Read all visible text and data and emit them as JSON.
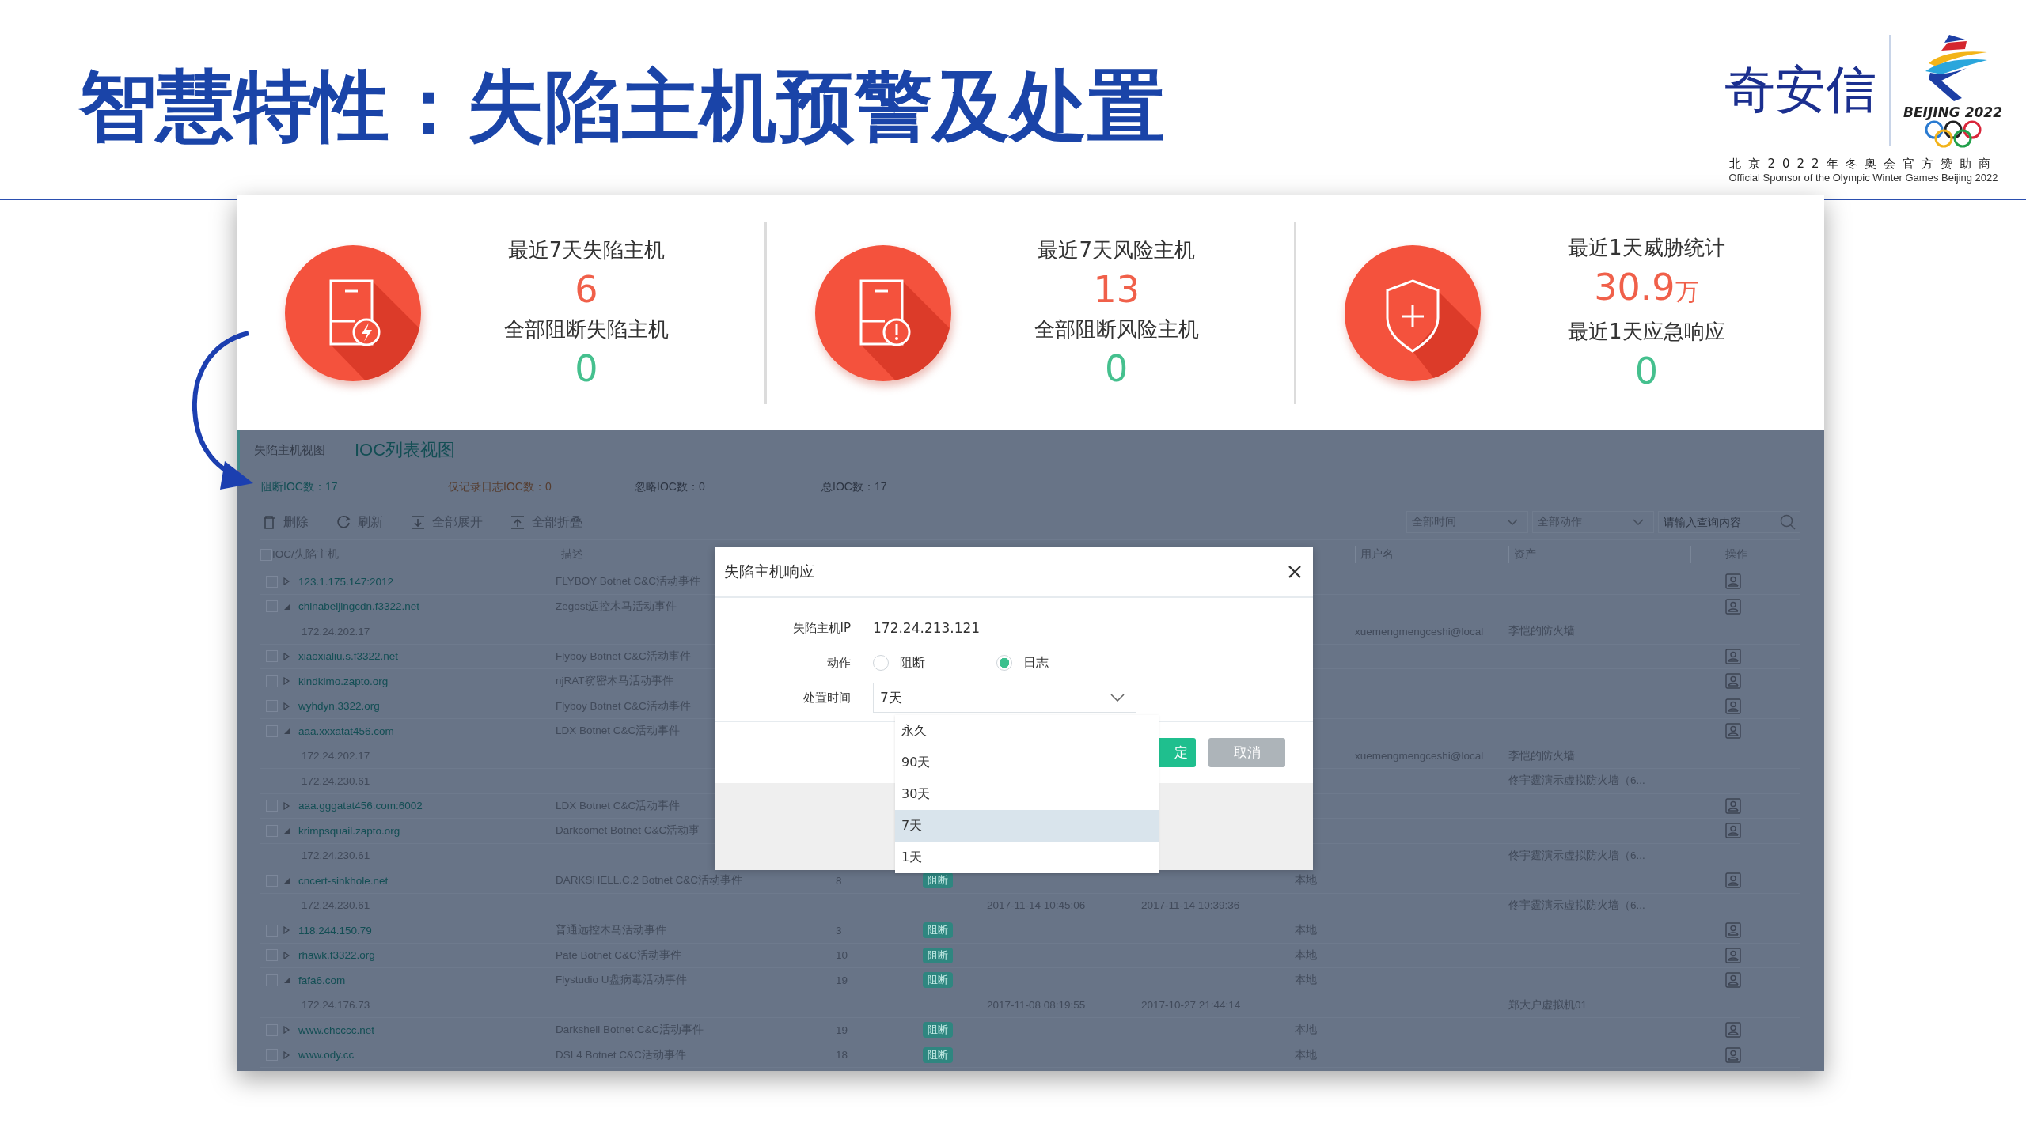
{
  "slide": {
    "title": "智慧特性：失陷主机预警及处置",
    "sponsor": {
      "brand": "奇安信",
      "emblem_text": "BEIJING 2022",
      "line_cn": "北京2022年冬奥会官方赞助商",
      "line_en": "Official Sponsor of the Olympic Winter Games Beijing 2022"
    }
  },
  "stats": [
    {
      "kind": "bolt",
      "label": "最近7天失陷主机",
      "value": "6",
      "sub_label": "全部阻断失陷主机",
      "sub_value": "0"
    },
    {
      "kind": "alert",
      "label": "最近7天风险主机",
      "value": "13",
      "sub_label": "全部阻断风险主机",
      "sub_value": "0"
    },
    {
      "kind": "shield",
      "label": "最近1天威胁统计",
      "value": "30.9",
      "unit": "万",
      "sub_label": "最近1天应急响应",
      "sub_value": "0"
    }
  ],
  "app": {
    "tabs": [
      {
        "label": "失陷主机视图",
        "selected": false
      },
      {
        "label": "IOC列表视图",
        "selected": true
      }
    ],
    "counters": [
      {
        "kind": "block",
        "text": "阻断IOC数：17"
      },
      {
        "kind": "log",
        "text": "仅记录日志IOC数：0"
      },
      {
        "kind": "ignore",
        "text": "忽略IOC数：0"
      },
      {
        "kind": "total",
        "text": "总IOC数：17"
      }
    ],
    "toolbar": [
      {
        "kind": "delete",
        "label": "删除"
      },
      {
        "kind": "refresh",
        "label": "刷新"
      },
      {
        "kind": "expand",
        "label": "全部展开"
      },
      {
        "kind": "collapse",
        "label": "全部折叠"
      }
    ],
    "filters": [
      {
        "value": "全部时间"
      },
      {
        "value": "全部动作"
      }
    ],
    "search": {
      "placeholder": "请输入查询内容"
    },
    "table": {
      "select_all": {
        "checked": false
      },
      "columns": [
        {
          "label": "IOC/失陷主机"
        },
        {
          "label": "描述"
        },
        {
          "label": "用户名"
        },
        {
          "label": "资产"
        },
        {
          "label": "操作"
        }
      ],
      "rows": [
        {
          "ioc": "123.1.175.147:2012",
          "description": "FLYBOY Botnet C&C活动事件",
          "checked": false,
          "expanded": false
        },
        {
          "ioc": "chinabeijingcdn.f3322.net",
          "description": "Zegost远控木马活动事件",
          "checked": false,
          "expanded": true,
          "children": [
            {
              "host": "172.24.202.17",
              "user": "xuemengmengceshi@local",
              "asset": "李恺的防火墙"
            }
          ]
        },
        {
          "ioc": "xiaoxialiu.s.f3322.net",
          "description": "Flyboy Botnet C&C活动事件",
          "checked": false,
          "expanded": false
        },
        {
          "ioc": "kindkimo.zapto.org",
          "description": "njRAT窃密木马活动事件",
          "checked": false,
          "expanded": false
        },
        {
          "ioc": "wyhdyn.3322.org",
          "description": "Flyboy Botnet C&C活动事件",
          "checked": false,
          "expanded": false
        },
        {
          "ioc": "aaa.xxxatat456.com",
          "description": "LDX Botnet C&C活动事件",
          "checked": false,
          "expanded": true,
          "children": [
            {
              "host": "172.24.202.17",
              "user": "xuemengmengceshi@local",
              "asset": "李恺的防火墙"
            },
            {
              "host": "172.24.230.61",
              "asset": "佟宇霆演示虚拟防火墙（6..."
            }
          ]
        },
        {
          "ioc": "aaa.gggatat456.com:6002",
          "description": "LDX Botnet C&C活动事件",
          "checked": false,
          "expanded": false
        },
        {
          "ioc": "krimpsquail.zapto.org",
          "description": "Darkcomet Botnet C&C活动事",
          "checked": false,
          "expanded": true,
          "children": [
            {
              "host": "172.24.230.61",
              "asset": "佟宇霆演示虚拟防火墙（6..."
            }
          ]
        },
        {
          "ioc": "cncert-sinkhole.net",
          "description": "DARKSHELL.C.2 Botnet C&C活动事件",
          "count": "8",
          "action": "阻断",
          "source": "本地",
          "checked": false,
          "expanded": true,
          "children": [
            {
              "host": "172.24.230.61",
              "first_seen": "2017-11-14 10:45:06",
              "last_seen": "2017-11-14 10:39:36",
              "asset": "佟宇霆演示虚拟防火墙（6..."
            }
          ]
        },
        {
          "ioc": "118.244.150.79",
          "description": "普通远控木马活动事件",
          "count": "3",
          "action": "阻断",
          "source": "本地",
          "checked": false,
          "expanded": false
        },
        {
          "ioc": "rhawk.f3322.org",
          "description": "Pate Botnet C&C活动事件",
          "count": "10",
          "action": "阻断",
          "source": "本地",
          "checked": false,
          "expanded": false
        },
        {
          "ioc": "fafa6.com",
          "description": "Flystudio U盘病毒活动事件",
          "count": "19",
          "action": "阻断",
          "source": "本地",
          "checked": false,
          "expanded": true,
          "children": [
            {
              "host": "172.24.176.73",
              "first_seen": "2017-11-08 08:19:55",
              "last_seen": "2017-10-27 21:44:14",
              "asset": "郑大户虚拟机01"
            }
          ]
        },
        {
          "ioc": "www.chcccc.net",
          "description": "Darkshell Botnet C&C活动事件",
          "count": "19",
          "action": "阻断",
          "source": "本地",
          "checked": false,
          "expanded": false
        },
        {
          "ioc": "www.ody.cc",
          "description": "DSL4 Botnet C&C活动事件",
          "count": "18",
          "action": "阻断",
          "source": "本地",
          "checked": false,
          "expanded": false
        }
      ]
    },
    "dialog": {
      "title": "失陷主机响应",
      "fields": [
        {
          "kind": "text",
          "label": "失陷主机IP",
          "value": "172.24.213.121"
        },
        {
          "kind": "radio",
          "label": "动作",
          "options": [
            {
              "label": "阻断",
              "selected": false
            },
            {
              "label": "日志",
              "selected": true
            }
          ]
        },
        {
          "kind": "select",
          "label": "处置时间",
          "value": "7天",
          "expanded": true,
          "options": [
            {
              "label": "永久",
              "selected": false
            },
            {
              "label": "90天",
              "selected": false
            },
            {
              "label": "30天",
              "selected": false
            },
            {
              "label": "7天",
              "selected": true
            },
            {
              "label": "1天",
              "selected": false
            }
          ]
        }
      ],
      "buttons": [
        {
          "kind": "primary",
          "label": "定"
        },
        {
          "kind": "secondary",
          "label": "取消"
        }
      ]
    }
  }
}
